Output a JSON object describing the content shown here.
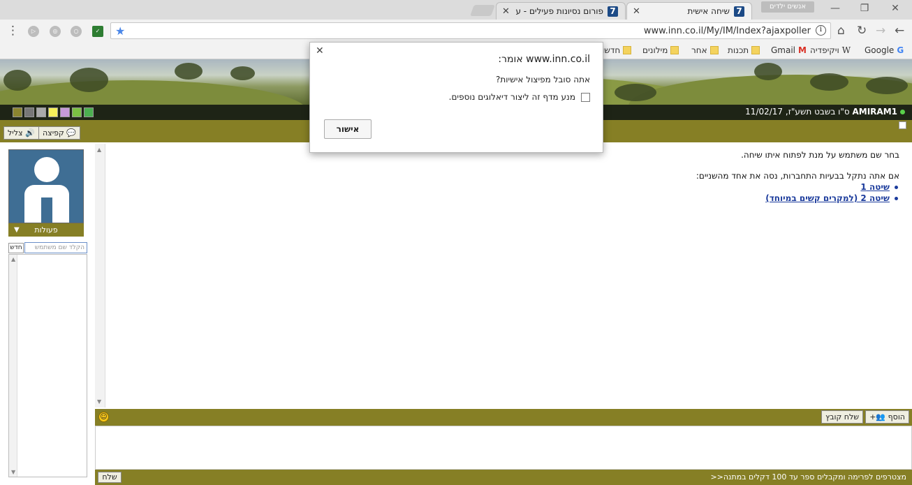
{
  "browser": {
    "tabs": [
      {
        "title": "שיחה אישית",
        "active": true
      },
      {
        "title": "פורום נסיונות פעילים - ע",
        "active": false
      }
    ],
    "incognito_label": "אנשים ילדים",
    "url": "www.inn.co.il/My/IM/Index?ajaxpoller",
    "bookmarks": [
      {
        "label": "Google",
        "icon": "google-icon"
      },
      {
        "label": "ויקיפדיה",
        "icon": "wikipedia-icon"
      },
      {
        "label": "Gmail",
        "icon": "gmail-icon"
      },
      {
        "label": "תכנות",
        "icon": "folder-icon"
      },
      {
        "label": "אחר",
        "icon": "folder-icon"
      },
      {
        "label": "מילונים",
        "icon": "folder-icon"
      },
      {
        "label": "חדשו",
        "icon": "folder-icon"
      }
    ]
  },
  "header": {
    "username": "AMIRAM1",
    "date": "ס\"ו בשבט תשע\"ז, 11/02/17",
    "swatch_colors": [
      "#6e9cc9",
      "#f4a460",
      "#f47c30",
      "#4caf50",
      "#7bc043",
      "#c69ad8",
      "#f5f05a",
      "#aaaaaa",
      "#777777",
      "#8b8530"
    ]
  },
  "toolbar": {
    "popup_label": "קפיצה",
    "tzlil_label": "צליל"
  },
  "sidebar": {
    "actions_label": "פעולות",
    "new_label": "חדש",
    "search_placeholder": "הקלד שם משתמש"
  },
  "main": {
    "intro": "בחר שם משתמש על מנת לפתוח איתו שיחה.",
    "trouble": "אם אתה נתקל בבעיות התחברות, נסה את אחד מהשניים:",
    "method1": "שיטה 1",
    "method2": "שיטה 2 (למקרים קשים במיוחד)"
  },
  "composer": {
    "add_label": "הוסף",
    "send_file_label": "שלח קובץ",
    "footer_text": "מצטרפים לפרימה ומקבלים ספר עד 100 דקלים במתנה<<",
    "send_label": "שלח"
  },
  "dialog": {
    "title": "www.inn.co.il אומר:",
    "message": "אתה סובל מפיצול אישיות?",
    "checkbox_label": "מנע מדף זה ליצור דיאלוגים נוספים.",
    "ok_label": "אישור"
  }
}
